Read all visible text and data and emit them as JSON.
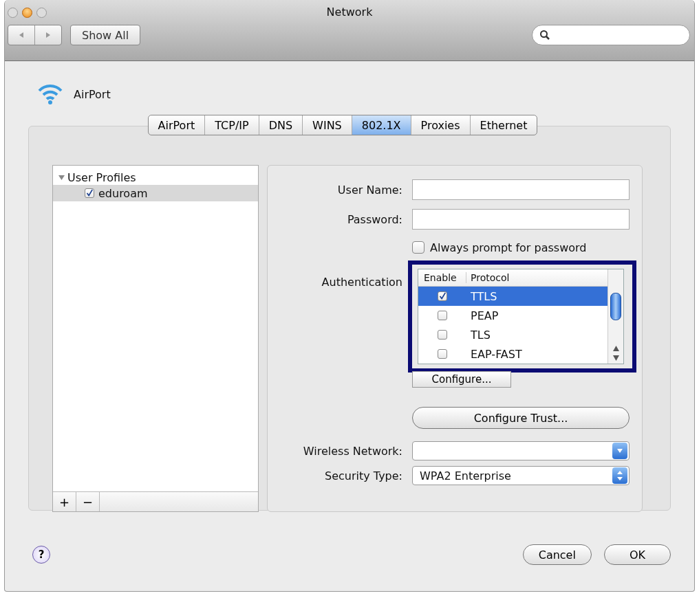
{
  "window": {
    "title": "Network"
  },
  "toolbar": {
    "show_all": "Show All"
  },
  "service": {
    "name": "AirPort"
  },
  "tabs": [
    {
      "label": "AirPort",
      "selected": false
    },
    {
      "label": "TCP/IP",
      "selected": false
    },
    {
      "label": "DNS",
      "selected": false
    },
    {
      "label": "WINS",
      "selected": false
    },
    {
      "label": "802.1X",
      "selected": true
    },
    {
      "label": "Proxies",
      "selected": false
    },
    {
      "label": "Ethernet",
      "selected": false
    }
  ],
  "profiles": {
    "label": "User Profiles",
    "expanded": true,
    "children": [
      {
        "label": "eduroam",
        "checked": true,
        "selected": true
      }
    ]
  },
  "form": {
    "user_name_label": "User Name:",
    "password_label": "Password:",
    "always_prompt": {
      "label": "Always prompt for password",
      "checked": false
    },
    "authentication_label": "Authentication",
    "protocol_table": {
      "columns": [
        "Enable",
        "Protocol"
      ],
      "rows": [
        {
          "protocol": "TTLS",
          "enabled": true,
          "selected": true
        },
        {
          "protocol": "PEAP",
          "enabled": false,
          "selected": false
        },
        {
          "protocol": "TLS",
          "enabled": false,
          "selected": false
        },
        {
          "protocol": "EAP-FAST",
          "enabled": false,
          "selected": false
        }
      ]
    },
    "configure_button": "Configure...",
    "configure_trust_button": "Configure Trust...",
    "wireless_network_label": "Wireless Network:",
    "security_type_label": "Security Type:",
    "security_type_value": "WPA2 Enterprise"
  },
  "list_buttons": [
    "+",
    "−"
  ],
  "help": "?",
  "buttons": [
    "Cancel",
    "OK"
  ]
}
